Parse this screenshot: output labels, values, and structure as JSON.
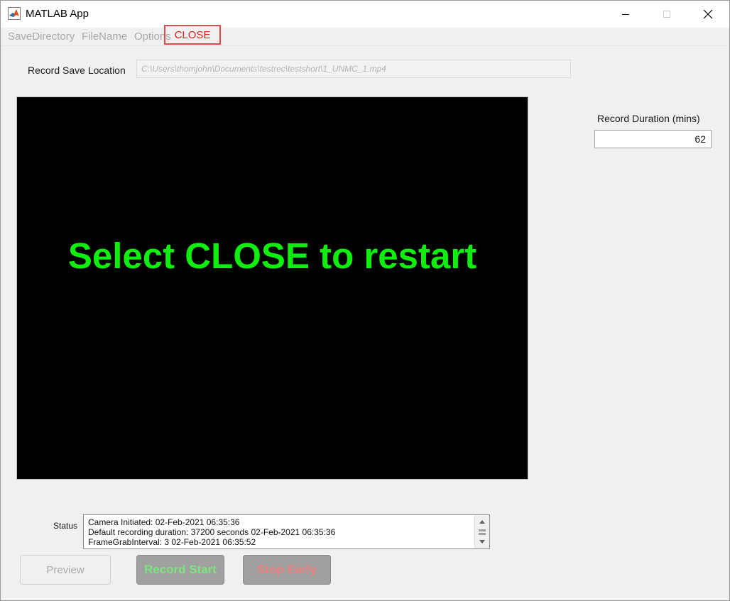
{
  "window": {
    "title": "MATLAB App"
  },
  "menu": {
    "items": [
      {
        "label": "SaveDirectory"
      },
      {
        "label": "FileName"
      },
      {
        "label": "Options"
      }
    ],
    "close_label": "CLOSE"
  },
  "save_location": {
    "label": "Record Save Location",
    "value": "C:\\Users\\thomjohn\\Documents\\testrec\\testshort\\1_UNMC_1.mp4"
  },
  "video": {
    "message": "Select CLOSE to restart",
    "message_color": "#10ee10"
  },
  "duration": {
    "label": "Record Duration (mins)",
    "value": "62"
  },
  "status": {
    "label": "Status",
    "lines": [
      "Camera Initiated: 02-Feb-2021 06:35:36",
      "Default recording duration: 37200 seconds 02-Feb-2021 06:35:36",
      "FrameGrabInterval: 3 02-Feb-2021 06:35:52"
    ]
  },
  "buttons": {
    "preview": "Preview",
    "record_start": "Record Start",
    "stop_early": "Stop Early"
  },
  "colors": {
    "close_text": "#e02020",
    "close_highlight": "#e04a4a",
    "record_text": "#7ee57e",
    "stop_text": "#f08080"
  }
}
